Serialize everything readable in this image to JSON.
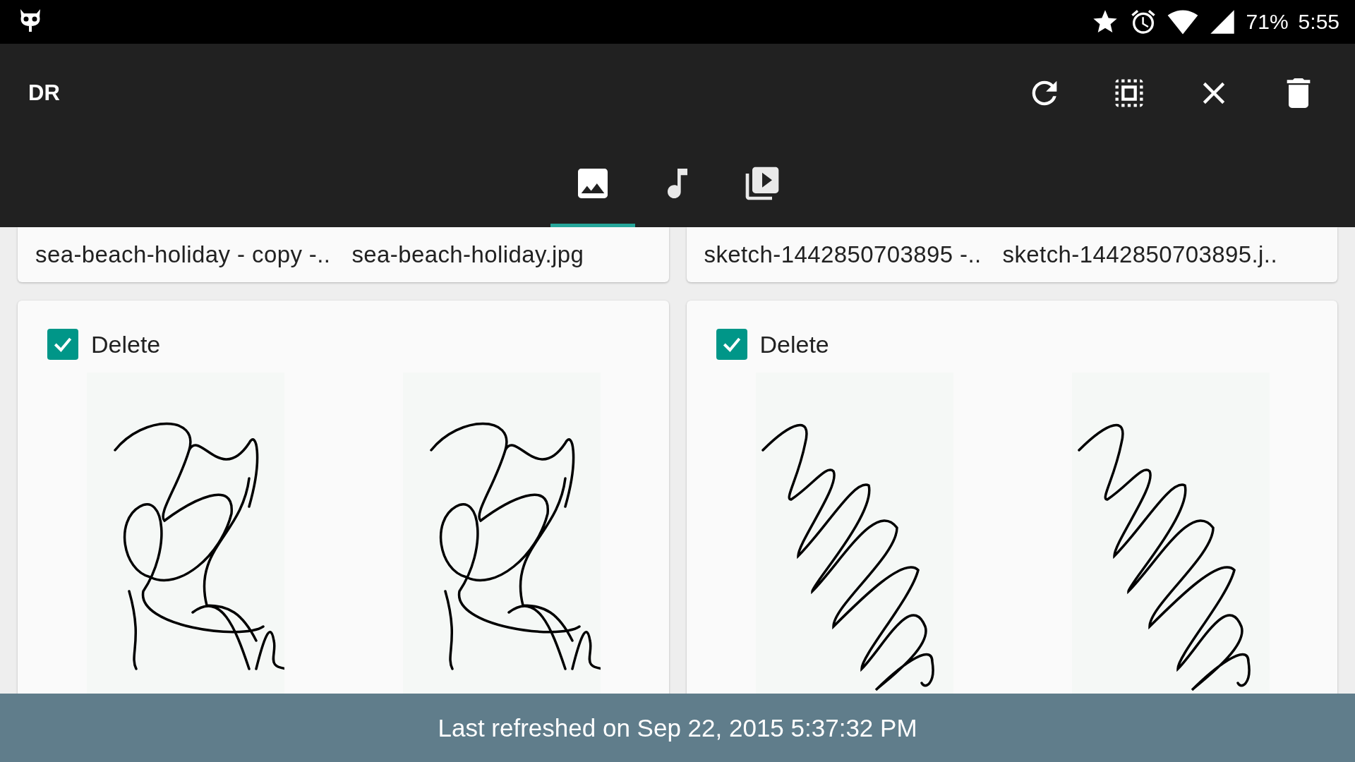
{
  "status_bar": {
    "battery": "71%",
    "time": "5:55"
  },
  "app_bar": {
    "title": "DR"
  },
  "tabs": [
    {
      "kind": "image",
      "selected": true
    },
    {
      "kind": "music",
      "selected": false
    },
    {
      "kind": "video",
      "selected": false
    }
  ],
  "file_rows": [
    {
      "names": [
        "sea-beach-holiday - copy -..",
        "sea-beach-holiday.jpg"
      ]
    },
    {
      "names": [
        "sketch-1442850703895 -..",
        "sketch-1442850703895.j.."
      ]
    }
  ],
  "duplicate_cards": [
    {
      "kind": "loops",
      "checkbox": {
        "label": "Delete",
        "checked": true
      }
    },
    {
      "kind": "zigzag",
      "checkbox": {
        "label": "Delete",
        "checked": true
      }
    }
  ],
  "snackbar": {
    "text": "Last refreshed on Sep 22, 2015 5:37:32 PM"
  }
}
